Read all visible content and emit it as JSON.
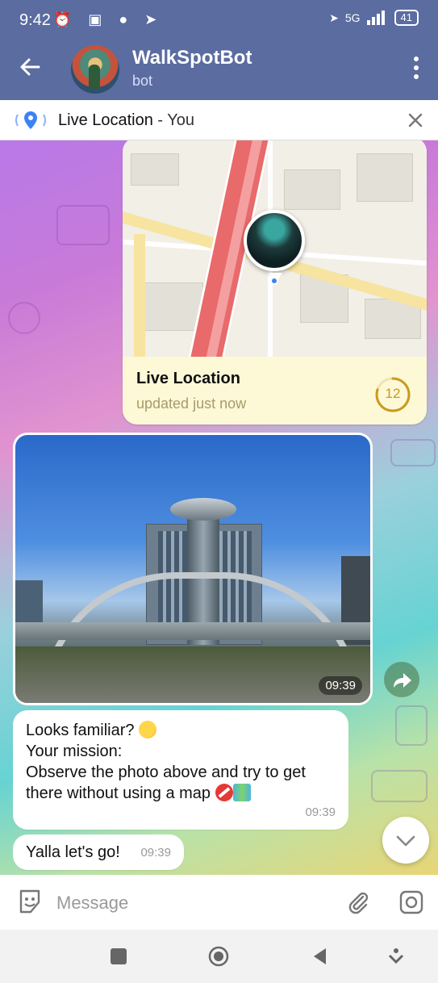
{
  "status_bar": {
    "time": "9:42",
    "battery": "41",
    "network": "5G"
  },
  "header": {
    "title": "WalkSpotBot",
    "subtitle": "bot",
    "back_icon": "arrow-left-icon",
    "menu_icon": "more-vert-icon"
  },
  "live_banner": {
    "label": "Live Location",
    "separator": " - ",
    "who": "You",
    "close_icon": "close-icon"
  },
  "live_location_message": {
    "title": "Live Location",
    "subtitle": "updated just now",
    "timer_value": "12",
    "timer_fraction_remaining": 0.8
  },
  "photo_message": {
    "time": "09:39"
  },
  "messages": [
    {
      "line1": "Looks familiar? ",
      "body": "\nYour mission:\nObserve the photo above and try to get there without using a map ",
      "time": "09:39"
    },
    {
      "text": "Yalla let's go!",
      "time": "09:39"
    }
  ],
  "composer": {
    "placeholder": "Message"
  },
  "colors": {
    "header_bg": "#5a6ca0",
    "accent_timer": "#c99a1d",
    "pin_blue": "#3b82f6"
  }
}
